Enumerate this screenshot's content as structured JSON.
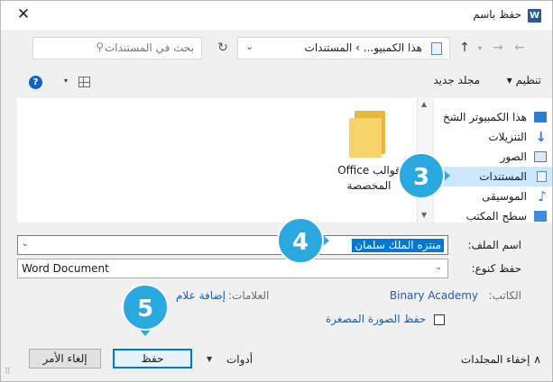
{
  "window": {
    "title": "حفظ باسم",
    "app_icon_letter": "W",
    "close_glyph": "✕"
  },
  "address_bar": {
    "search_placeholder": "بحث في المستندات",
    "path": "هذا الكمبيو... › المستندات",
    "path_separator": "›",
    "refresh_glyph": "↻",
    "dropdown_glyph": "⌄"
  },
  "nav_buttons": {
    "back_glyph": "←",
    "forward_glyph": "→",
    "recent_glyph": "▾",
    "up_glyph": "↑"
  },
  "command_bar": {
    "organize_label": "تنظيم ▾",
    "new_folder_label": "مجلد جديد",
    "help_glyph": "?",
    "view_dropdown_glyph": "▾"
  },
  "navigation_pane": {
    "items": [
      {
        "label": "هذا الكمبيوتر الشخ",
        "icon": "computer-icon"
      },
      {
        "label": "التنزيلات",
        "icon": "download-icon"
      },
      {
        "label": "الصور",
        "icon": "pictures-icon"
      },
      {
        "label": "المستندات",
        "icon": "documents-icon",
        "selected": true
      },
      {
        "label": "الموسيقى",
        "icon": "music-icon"
      },
      {
        "label": "سطح المكتب",
        "icon": "desktop-icon"
      }
    ]
  },
  "files": [
    {
      "name_line1": "Office قوالب",
      "name_line2": "المخصصة",
      "icon": "folder-icon"
    }
  ],
  "form": {
    "filename_label": "اسم الملف:",
    "filename_value": "منتزه الملك سلمان",
    "filetype_label": "حفظ كنوع:",
    "filetype_value": "Word Document",
    "author_label": "الكاتب:",
    "author_value": "Binary Academy",
    "tags_label": "العلامات:",
    "tags_value": "إضافة علام",
    "thumbnail_label": "حفظ الصورة المصغرة",
    "thumbnail_checked": false
  },
  "bottom_bar": {
    "hide_folders_label": "∧ إخفاء المجلدات",
    "tools_label": "أدوات",
    "save_label": "حفظ",
    "cancel_label": "إلغاء الأمر"
  },
  "step_badges": [
    "3",
    "4",
    "5"
  ],
  "colors": {
    "accent": "#0078d7",
    "badge": "#29a9e0",
    "selection": "#cce8ff",
    "link": "#1a5fb4"
  }
}
